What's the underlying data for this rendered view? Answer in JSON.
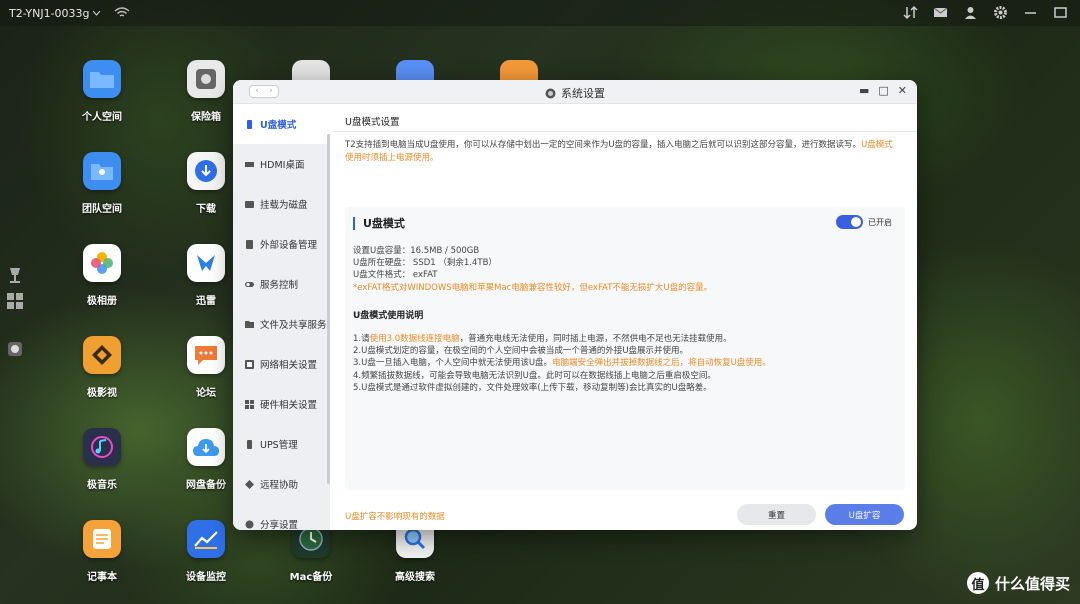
{
  "topbar": {
    "device_name": "T2-YNJ1-0033g"
  },
  "desktop": {
    "icons": [
      {
        "label": "个人空间",
        "color": "#3d8ef0"
      },
      {
        "label": "保险箱",
        "color": "#e9e9e9"
      },
      {
        "label": "团队空间",
        "color": "#3d8ef0"
      },
      {
        "label": "下载",
        "color": "#f5f5f5"
      },
      {
        "label": "极相册",
        "color": "#ffffff"
      },
      {
        "label": "迅雷",
        "color": "#ffffff"
      },
      {
        "label": "极影视",
        "color": "#f0a030"
      },
      {
        "label": "论坛",
        "color": "#ffffff"
      },
      {
        "label": "极音乐",
        "color": "#2a2f4a"
      },
      {
        "label": "网盘备份",
        "color": "#ffffff"
      },
      {
        "label": "记事本",
        "color": "#f5a23a"
      },
      {
        "label": "设备监控",
        "color": "#2f6fe8"
      },
      {
        "label": "Mac备份",
        "color": "#1e3a2a"
      },
      {
        "label": "高级搜索",
        "color": "#f0f0f0"
      }
    ]
  },
  "window": {
    "title": "系统设置",
    "sidebar": [
      {
        "label": "U盘模式"
      },
      {
        "label": "HDMI桌面"
      },
      {
        "label": "挂载为磁盘"
      },
      {
        "label": "外部设备管理"
      },
      {
        "label": "服务控制"
      },
      {
        "label": "文件及共享服务"
      },
      {
        "label": "网络相关设置"
      },
      {
        "label": "硬件相关设置"
      },
      {
        "label": "UPS管理"
      },
      {
        "label": "远程协助"
      },
      {
        "label": "分享设置"
      }
    ],
    "content": {
      "heading": "U盘模式设置",
      "desc_main": "T2支持插到电脑当成U盘使用，你可以从存储中划出一定的空间来作为U盘的容量，插入电脑之后就可以识别这部分容量，进行数据读写。",
      "desc_orange": "U盘模式使用时须插上电源使用。",
      "card_title": "U盘模式",
      "toggle_label": "已开启",
      "info": [
        "设置U盘容量：16.5MB / 500GB",
        "U盘所在硬盘：  SSD1  （剩余1.4TB）",
        "U盘文件格式：   exFAT"
      ],
      "info_warning": "*exFAT格式对WINDOWS电脑和苹果Mac电脑兼容性较好，但exFAT不能无损扩大U盘的容量。",
      "usage_title": "U盘模式使用说明",
      "step1_a": "1.请",
      "step1_b": "使用3.0数据线连接电脑",
      "step1_c": "，普通充电线无法使用，同时插上电源，不然供电不足也无法挂载使用。",
      "step2": "2.U盘模式划定的容量，在极空间的个人空间中会被当成一个普通的外接U盘展示并使用。",
      "step3_a": "3.U盘一旦插入电脑，个人空间中就无法使用该U盘。",
      "step3_b": "电脑端安全弹出并拔掉数据线之后，将自动恢复U盘使用。",
      "step4": "4.频繁插拔数据线，可能会导致电脑无法识别U盘。此时可以在数据线插上电脑之后重启极空间。",
      "step5": "5.U盘模式是通过软件虚拟创建的，文件处理效率(上传下载，移动复制等)会比真实的U盘略差。",
      "footnote": "U盘扩容不影响现有的数据",
      "reset_label": "重置",
      "expand_label": "U盘扩容"
    }
  },
  "watermark": {
    "text": "什么值得买",
    "glyph": "值"
  },
  "colors": {
    "accent": "#2f5fe8",
    "warning": "#f08a24",
    "primary_button": "#5b7de8"
  }
}
